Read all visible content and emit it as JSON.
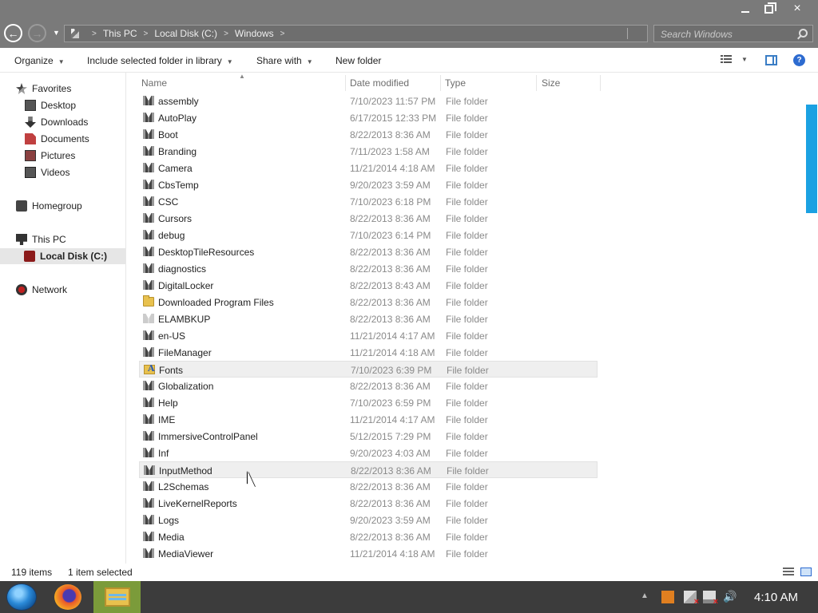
{
  "window": {
    "controls": {
      "minimize": "minimize",
      "maximize": "restore",
      "close": "×"
    }
  },
  "address": {
    "crumbs": [
      "This PC",
      "Local Disk (C:)",
      "Windows"
    ],
    "search_placeholder": "Search Windows"
  },
  "command_bar": {
    "organize": "Organize",
    "include": "Include selected folder in library",
    "share": "Share with",
    "new_folder": "New folder",
    "help": "?"
  },
  "nav": {
    "favorites": "Favorites",
    "desktop": "Desktop",
    "downloads": "Downloads",
    "documents": "Documents",
    "pictures": "Pictures",
    "videos": "Videos",
    "homegroup": "Homegroup",
    "this_pc": "This PC",
    "local_disk": "Local Disk (C:)",
    "network": "Network"
  },
  "columns": {
    "name": "Name",
    "date": "Date modified",
    "type": "Type",
    "size": "Size"
  },
  "files": [
    {
      "name": "assembly",
      "date": "7/10/2023 11:57 PM",
      "type": "File folder",
      "icon": "system-folder-icon"
    },
    {
      "name": "AutoPlay",
      "date": "6/17/2015 12:33 PM",
      "type": "File folder",
      "icon": "system-folder-icon"
    },
    {
      "name": "Boot",
      "date": "8/22/2013 8:36 AM",
      "type": "File folder",
      "icon": "system-folder-icon"
    },
    {
      "name": "Branding",
      "date": "7/11/2023 1:58 AM",
      "type": "File folder",
      "icon": "system-folder-icon"
    },
    {
      "name": "Camera",
      "date": "11/21/2014 4:18 AM",
      "type": "File folder",
      "icon": "system-folder-icon"
    },
    {
      "name": "CbsTemp",
      "date": "9/20/2023 3:59 AM",
      "type": "File folder",
      "icon": "system-folder-icon"
    },
    {
      "name": "CSC",
      "date": "7/10/2023 6:18 PM",
      "type": "File folder",
      "icon": "system-folder-icon"
    },
    {
      "name": "Cursors",
      "date": "8/22/2013 8:36 AM",
      "type": "File folder",
      "icon": "system-folder-icon"
    },
    {
      "name": "debug",
      "date": "7/10/2023 6:14 PM",
      "type": "File folder",
      "icon": "system-folder-icon"
    },
    {
      "name": "DesktopTileResources",
      "date": "8/22/2013 8:36 AM",
      "type": "File folder",
      "icon": "system-folder-icon"
    },
    {
      "name": "diagnostics",
      "date": "8/22/2013 8:36 AM",
      "type": "File folder",
      "icon": "system-folder-icon"
    },
    {
      "name": "DigitalLocker",
      "date": "8/22/2013 8:43 AM",
      "type": "File folder",
      "icon": "system-folder-icon"
    },
    {
      "name": "Downloaded Program Files",
      "date": "8/22/2013 8:36 AM",
      "type": "File folder",
      "icon": "yellow-folder-icon"
    },
    {
      "name": "ELAMBKUP",
      "date": "8/22/2013 8:36 AM",
      "type": "File folder",
      "icon": "hidden-folder-icon"
    },
    {
      "name": "en-US",
      "date": "11/21/2014 4:17 AM",
      "type": "File folder",
      "icon": "system-folder-icon"
    },
    {
      "name": "FileManager",
      "date": "11/21/2014 4:18 AM",
      "type": "File folder",
      "icon": "system-folder-icon"
    },
    {
      "name": "Fonts",
      "date": "7/10/2023 6:39 PM",
      "type": "File folder",
      "icon": "fonts-folder-icon",
      "selected": true
    },
    {
      "name": "Globalization",
      "date": "8/22/2013 8:36 AM",
      "type": "File folder",
      "icon": "system-folder-icon"
    },
    {
      "name": "Help",
      "date": "7/10/2023 6:59 PM",
      "type": "File folder",
      "icon": "system-folder-icon"
    },
    {
      "name": "IME",
      "date": "11/21/2014 4:17 AM",
      "type": "File folder",
      "icon": "system-folder-icon"
    },
    {
      "name": "ImmersiveControlPanel",
      "date": "5/12/2015 7:29 PM",
      "type": "File folder",
      "icon": "system-folder-icon"
    },
    {
      "name": "Inf",
      "date": "9/20/2023 4:03 AM",
      "type": "File folder",
      "icon": "system-folder-icon"
    },
    {
      "name": "InputMethod",
      "date": "8/22/2013 8:36 AM",
      "type": "File folder",
      "icon": "system-folder-icon",
      "hover": true
    },
    {
      "name": "L2Schemas",
      "date": "8/22/2013 8:36 AM",
      "type": "File folder",
      "icon": "system-folder-icon"
    },
    {
      "name": "LiveKernelReports",
      "date": "8/22/2013 8:36 AM",
      "type": "File folder",
      "icon": "system-folder-icon"
    },
    {
      "name": "Logs",
      "date": "9/20/2023 3:59 AM",
      "type": "File folder",
      "icon": "system-folder-icon"
    },
    {
      "name": "Media",
      "date": "8/22/2013 8:36 AM",
      "type": "File folder",
      "icon": "system-folder-icon"
    },
    {
      "name": "MediaViewer",
      "date": "11/21/2014 4:18 AM",
      "type": "File folder",
      "icon": "system-folder-icon"
    }
  ],
  "status": {
    "count": "119 items",
    "selected": "1 item selected"
  },
  "taskbar": {
    "clock": "4:10 AM"
  },
  "colors": {
    "accent": "#1ba1e2",
    "chrome": "#7a7a7a",
    "taskbar": "#3c3c3c",
    "explorer_active": "#7b9b3a"
  }
}
